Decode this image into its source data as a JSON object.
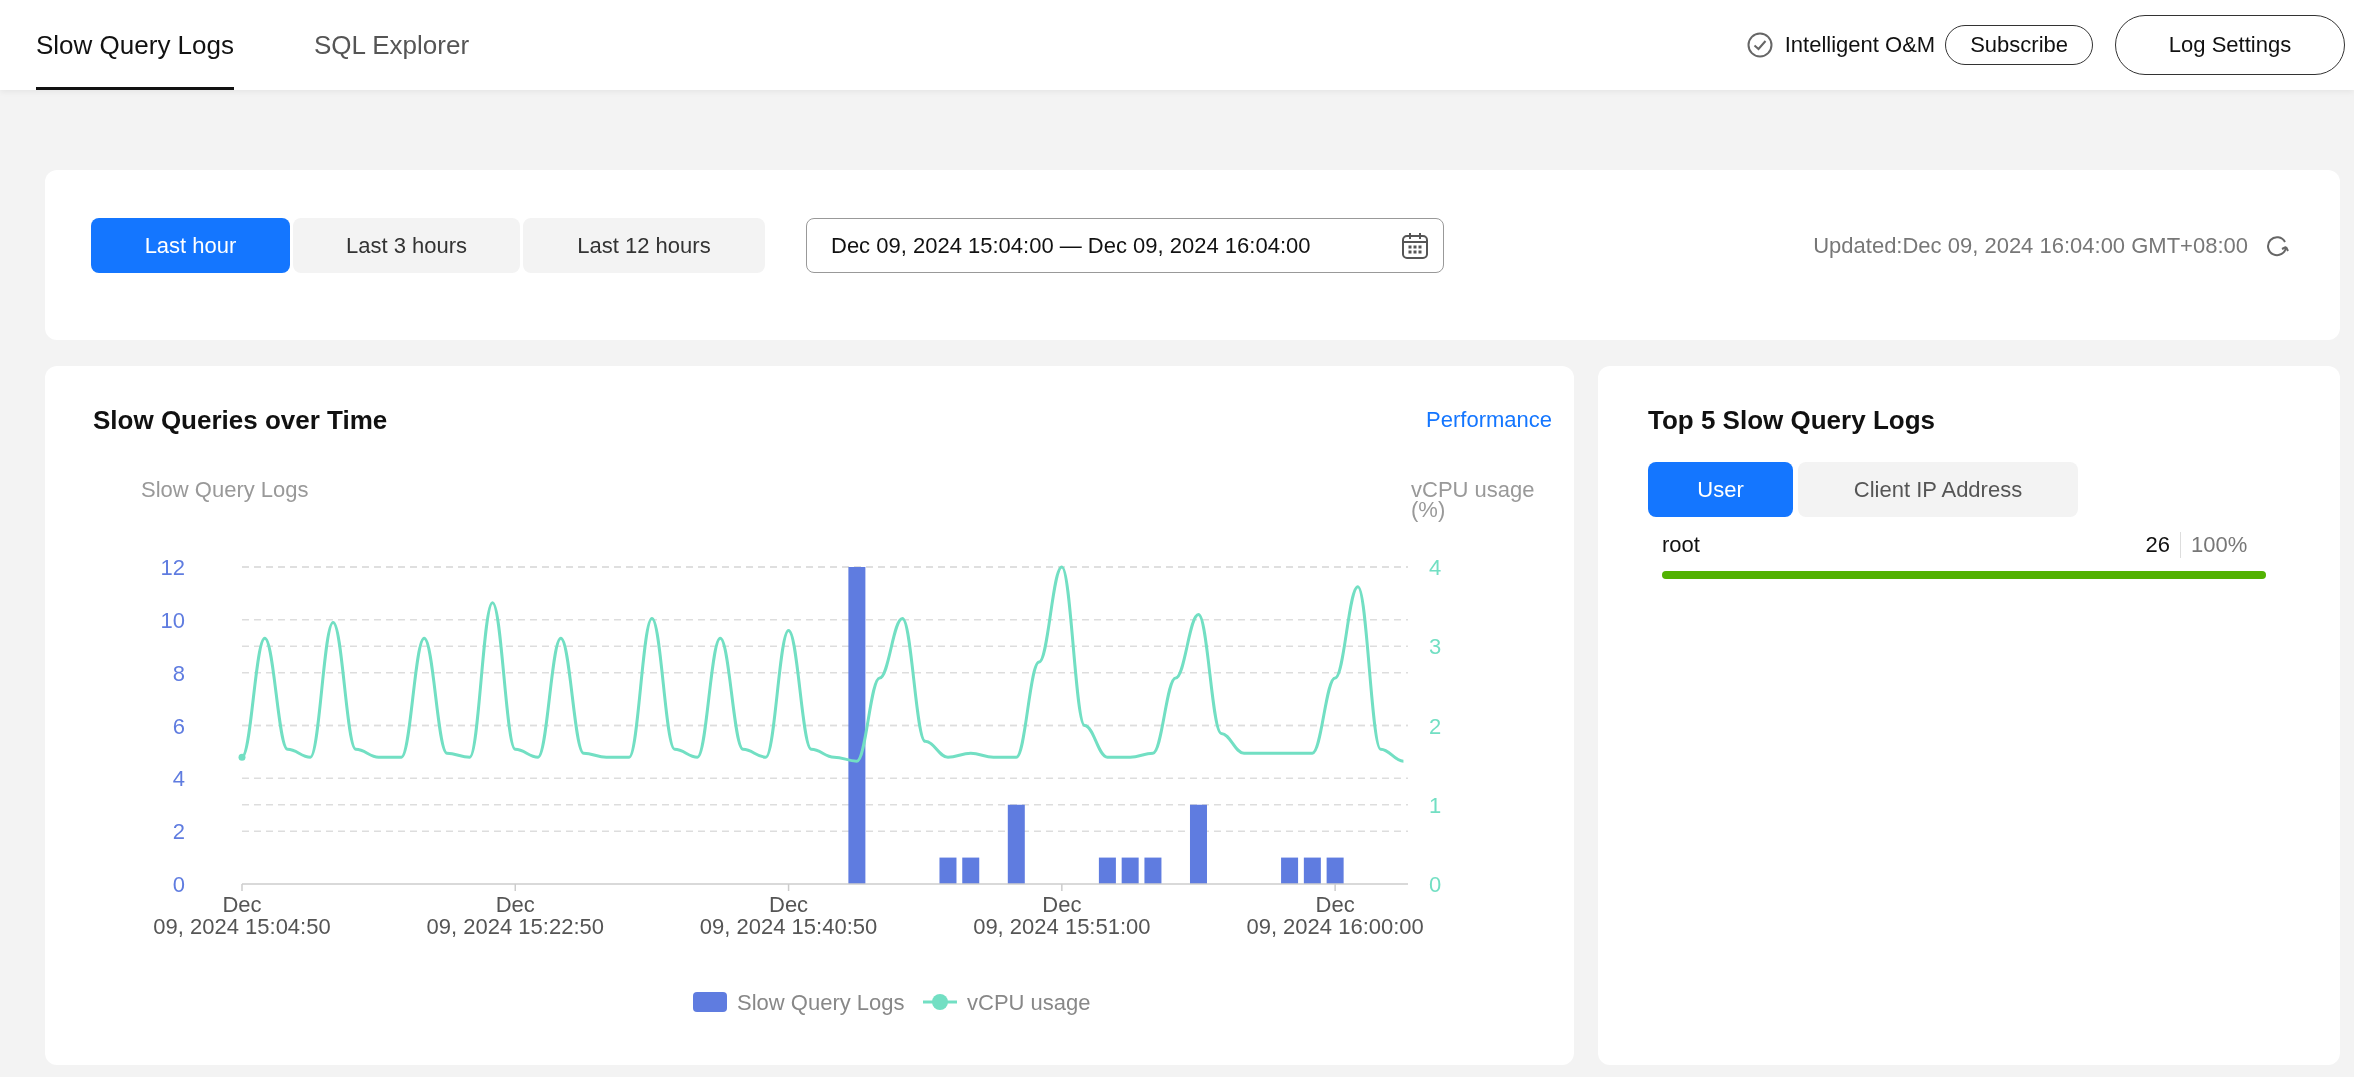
{
  "tabs": [
    {
      "label": "Slow Query Logs",
      "selected": true
    },
    {
      "label": "SQL Explorer",
      "selected": false
    }
  ],
  "header_actions": {
    "intelligent_om": "Intelligent O&M",
    "subscribe": "Subscribe",
    "log_settings": "Log Settings"
  },
  "time_filter": {
    "ranges": [
      {
        "label": "Last hour",
        "selected": true
      },
      {
        "label": "Last 3 hours",
        "selected": false
      },
      {
        "label": "Last 12 hours",
        "selected": false
      }
    ],
    "date_range": "Dec 09, 2024 15:04:00 — Dec 09, 2024 16:04:00",
    "updated": "Updated:Dec 09, 2024 16:04:00 GMT+08:00"
  },
  "slow_queries_chart": {
    "title": "Slow Queries over Time",
    "link": "Performance",
    "chart_data": {
      "type": "bar",
      "ylabel": "Slow Query Logs",
      "y2label": "vCPU usage (%)",
      "categories": [
        "Dec 09, 2024 15:04:50",
        null,
        null,
        null,
        null,
        null,
        null,
        null,
        null,
        null,
        null,
        null,
        "Dec 09, 2024 15:22:50",
        null,
        null,
        null,
        null,
        null,
        null,
        null,
        null,
        null,
        null,
        null,
        "Dec 09, 2024 15:40:50",
        null,
        null,
        null,
        null,
        null,
        null,
        null,
        null,
        null,
        null,
        null,
        "Dec 09, 2024 15:51:00",
        null,
        null,
        null,
        null,
        null,
        null,
        null,
        null,
        null,
        null,
        null,
        "Dec 09, 2024 16:00:00",
        null,
        null,
        null
      ],
      "ylim": [
        0,
        12
      ],
      "yticks": [
        0,
        2,
        4,
        6,
        8,
        10,
        12
      ],
      "y2lim": [
        0,
        4
      ],
      "y2ticks": [
        0,
        1,
        2,
        3,
        4
      ],
      "grid": true,
      "legend": "bottom",
      "series": [
        {
          "name": "Slow Query Logs",
          "color": "#5f7ce0",
          "values": [
            null,
            null,
            null,
            null,
            null,
            null,
            null,
            null,
            null,
            null,
            null,
            null,
            null,
            null,
            null,
            null,
            null,
            null,
            null,
            null,
            null,
            null,
            null,
            null,
            null,
            null,
            null,
            12,
            null,
            null,
            null,
            1,
            1,
            null,
            3,
            null,
            null,
            null,
            1,
            1,
            1,
            null,
            3,
            null,
            null,
            null,
            1,
            1,
            1,
            null,
            null,
            null
          ]
        },
        {
          "name": "vCPU usage",
          "type": "line",
          "axis": "y2",
          "color": "#72dfc3",
          "values": [
            1.6,
            3.1,
            1.7,
            1.6,
            3.3,
            1.7,
            1.6,
            1.6,
            3.1,
            1.65,
            1.6,
            3.55,
            1.7,
            1.6,
            3.1,
            1.65,
            1.6,
            1.6,
            3.35,
            1.7,
            1.6,
            3.1,
            1.7,
            1.6,
            3.2,
            1.7,
            1.6,
            1.55,
            2.6,
            3.35,
            1.8,
            1.6,
            1.65,
            1.6,
            1.6,
            2.8,
            4.0,
            2.0,
            1.6,
            1.6,
            1.65,
            2.6,
            3.4,
            1.9,
            1.65,
            1.65,
            1.65,
            1.65,
            2.6,
            3.75,
            1.7,
            1.55
          ]
        }
      ]
    }
  },
  "top5": {
    "title": "Top 5 Slow Query Logs",
    "tabs": [
      {
        "label": "User",
        "selected": true
      },
      {
        "label": "Client IP Address",
        "selected": false
      }
    ],
    "rows": [
      {
        "name": "root",
        "count": "26",
        "share": "100%",
        "level": 1
      }
    ]
  }
}
